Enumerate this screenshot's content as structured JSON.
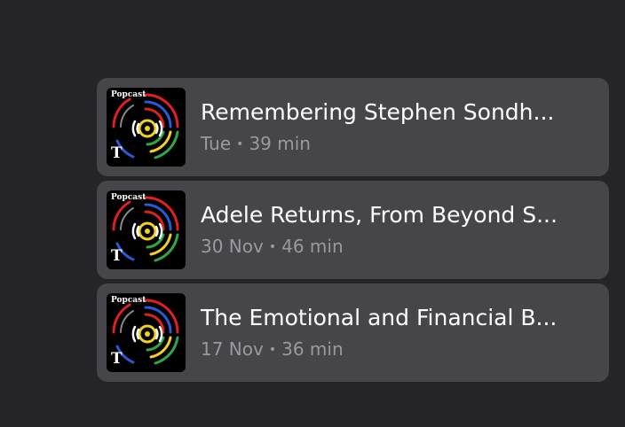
{
  "episodes": [
    {
      "artwork_label": "Popcast",
      "artwork_logo": "T",
      "title": "Remembering Stephen Sondh...",
      "date": "Tue",
      "separator": "•",
      "duration": "39 min"
    },
    {
      "artwork_label": "Popcast",
      "artwork_logo": "T",
      "title": "Adele Returns, From Beyond S...",
      "date": "30 Nov",
      "separator": "•",
      "duration": "46 min"
    },
    {
      "artwork_label": "Popcast",
      "artwork_logo": "T",
      "title": "The Emotional and Financial B...",
      "date": "17 Nov",
      "separator": "•",
      "duration": "36 min"
    }
  ],
  "colors": {
    "background": "#252428",
    "card": "#464549",
    "title": "#ffffff",
    "meta": "#9a999e",
    "art_red": "#e02020",
    "art_blue": "#2b59d6",
    "art_yellow": "#f2d21b",
    "art_green": "#2fa64a"
  }
}
